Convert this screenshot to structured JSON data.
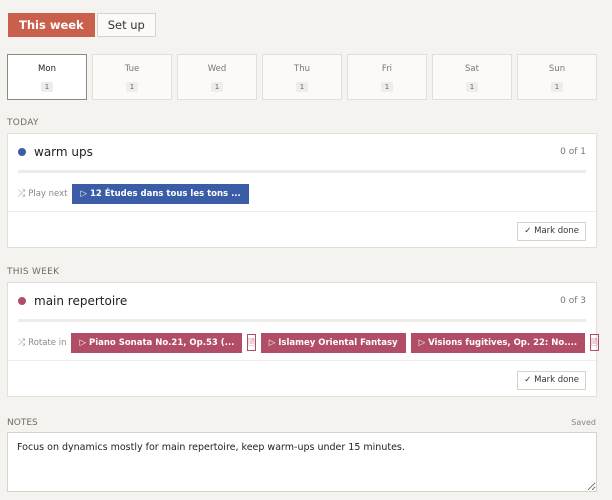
{
  "tabs": [
    {
      "label": "This week",
      "active": true
    },
    {
      "label": "Set up",
      "active": false
    }
  ],
  "days": [
    {
      "name": "Mon",
      "count": "1",
      "selected": true
    },
    {
      "name": "Tue",
      "count": "1"
    },
    {
      "name": "Wed",
      "count": "1"
    },
    {
      "name": "Thu",
      "count": "1"
    },
    {
      "name": "Fri",
      "count": "1"
    },
    {
      "name": "Sat",
      "count": "1"
    },
    {
      "name": "Sun",
      "count": "1"
    }
  ],
  "today": {
    "section_label": "TODAY",
    "title": "warm ups",
    "count": "0 of 1",
    "progress": 0,
    "dot_color": "#3b5da8",
    "row_label": "Play next",
    "chips": [
      "▷ 12 Études dans tous les tons ..."
    ],
    "mark_done": "✓ Mark done"
  },
  "week": {
    "section_label": "THIS WEEK",
    "title": "main repertoire",
    "count": "0 of 3",
    "progress": 0,
    "dot_color": "#b24d68",
    "row_label": "Rotate in",
    "chips": [
      "▷ Piano Sonata No.21, Op.53 (...",
      "▷ Islamey Oriental Fantasy",
      "▷ Visions fugitives, Op. 22: No...."
    ],
    "mark_done": "✓ Mark done"
  },
  "notes": {
    "label": "NOTES",
    "status": "Saved",
    "value": "Focus on dynamics mostly for main repertoire, keep warm-ups under 15 minutes."
  },
  "icons": {
    "shuffle": "⤮",
    "score": "🗎"
  }
}
